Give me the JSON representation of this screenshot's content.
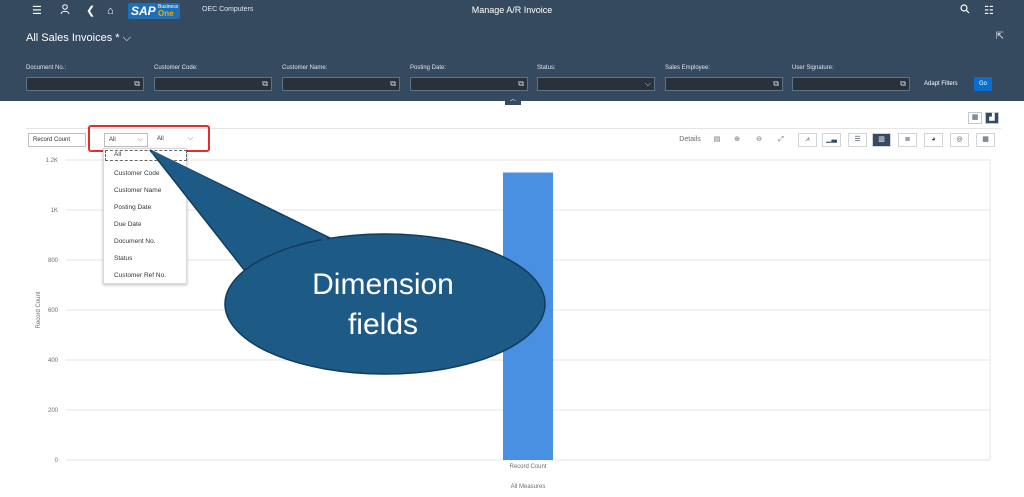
{
  "topbar": {
    "menu_icon": "hamburger-icon",
    "user_icon": "user-icon",
    "back_icon": "back-icon",
    "home_icon": "home-icon",
    "logo_sap": "SAP",
    "logo_business": "Business",
    "logo_one": "One",
    "company": "OEC Computers",
    "title": "Manage A/R Invoice",
    "search_icon": "search-icon",
    "menu2_icon": "list-icon"
  },
  "header": {
    "variant": "All Sales Invoices *",
    "filters": [
      {
        "label": "Document No.:",
        "value": ""
      },
      {
        "label": "Customer Code:",
        "value": ""
      },
      {
        "label": "Customer Name:",
        "value": ""
      },
      {
        "label": "Posting Date:",
        "value": ""
      },
      {
        "label": "Status:",
        "value": ""
      },
      {
        "label": "Sales Employee:",
        "value": ""
      },
      {
        "label": "User Signature:",
        "value": ""
      }
    ],
    "adapt_filters": "Adapt Filters",
    "go": "Go"
  },
  "toolbar": {
    "measure": "Record Count",
    "dim1": "All",
    "dim2": "All",
    "details": "Details"
  },
  "dropdown": {
    "options": [
      "All",
      "Customer Code",
      "Customer Name",
      "Posting Date",
      "Due Date",
      "Document No.",
      "Status",
      "Customer Ref No."
    ]
  },
  "callout": {
    "line1": "Dimension",
    "line2": "fields"
  },
  "chart_data": {
    "type": "bar",
    "categories": [
      "Record Count"
    ],
    "values": [
      1150
    ],
    "xlabel": "All Measures",
    "ylabel": "Record Count",
    "ylim": [
      0,
      1200
    ],
    "yticks": [
      0,
      200,
      400,
      600,
      800,
      1000,
      1200
    ],
    "ytick_labels": [
      "0",
      "200",
      "400",
      "600",
      "800",
      "1K",
      "1.2K"
    ],
    "grid": true,
    "bar_color": "#4a90e2"
  }
}
